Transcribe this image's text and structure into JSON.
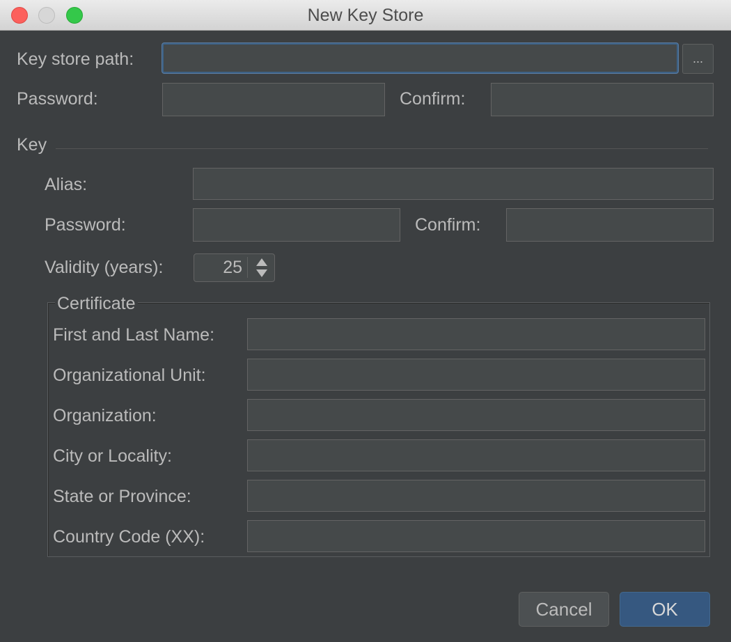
{
  "window": {
    "title": "New Key Store"
  },
  "keystore": {
    "path_label": "Key store path:",
    "path_value": "",
    "browse_label": "...",
    "password_label": "Password:",
    "confirm_label": "Confirm:"
  },
  "key": {
    "section_label": "Key",
    "alias_label": "Alias:",
    "password_label": "Password:",
    "confirm_label": "Confirm:",
    "validity_label": "Validity (years):",
    "validity_value": "25"
  },
  "certificate": {
    "title": "Certificate",
    "first_last_name_label": "First and Last Name:",
    "org_unit_label": "Organizational Unit:",
    "organization_label": "Organization:",
    "city_label": "City or Locality:",
    "state_label": "State or Province:",
    "country_label": "Country Code (XX):"
  },
  "buttons": {
    "cancel": "Cancel",
    "ok": "OK"
  },
  "colors": {
    "background": "#3c3f41",
    "field_bg": "#45494a",
    "focus_border": "#3d6185",
    "ok_button": "#365880",
    "close": "#fc605c",
    "minimize": "#d7d7d7",
    "maximize": "#34c84a"
  }
}
